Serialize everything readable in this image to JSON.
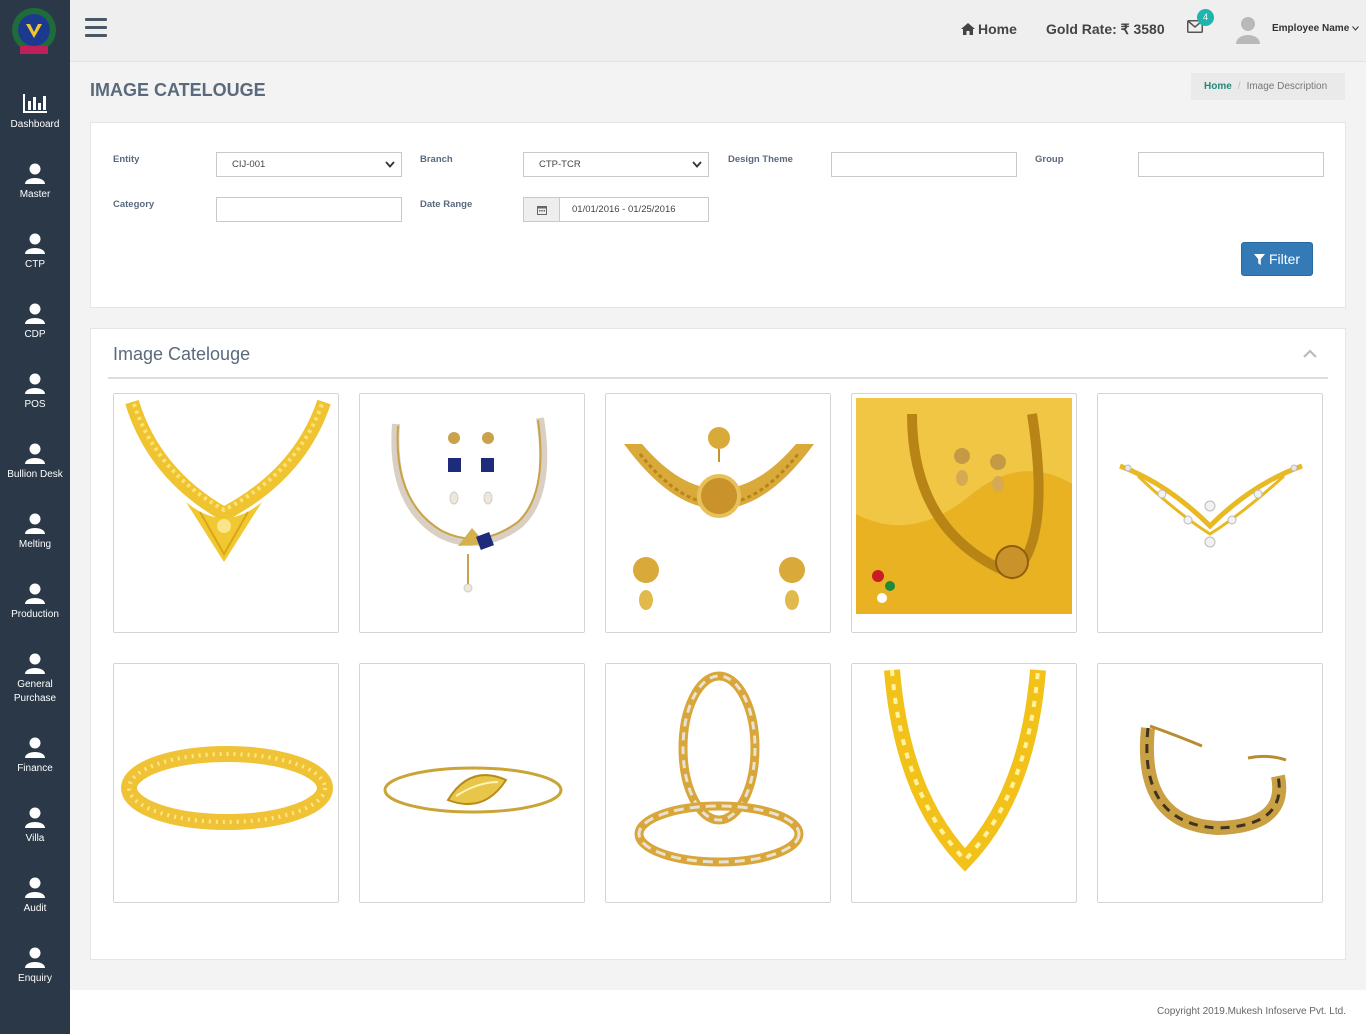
{
  "sidebar": {
    "logo_icon": "lion-emblem-logo-icon",
    "items": [
      {
        "label": "Dashboard",
        "icon": "bar-chart-icon"
      },
      {
        "label": "Master",
        "icon": "user-icon"
      },
      {
        "label": "CTP",
        "icon": "user-icon"
      },
      {
        "label": "CDP",
        "icon": "user-icon"
      },
      {
        "label": "POS",
        "icon": "user-icon"
      },
      {
        "label": "Bullion Desk",
        "icon": "user-icon"
      },
      {
        "label": "Melting",
        "icon": "user-icon"
      },
      {
        "label": "Production",
        "icon": "user-icon"
      },
      {
        "label": "General Purchase",
        "icon": "user-icon"
      },
      {
        "label": "Finance",
        "icon": "user-icon"
      },
      {
        "label": "Villa",
        "icon": "user-icon"
      },
      {
        "label": "Audit",
        "icon": "user-icon"
      },
      {
        "label": "Enquiry",
        "icon": "user-icon"
      }
    ]
  },
  "header": {
    "home_label": "Home",
    "gold_rate": "Gold Rate: ₹ 3580",
    "mail_count": "4",
    "employee_name": "Employee Name"
  },
  "page": {
    "title": "IMAGE CATELOUGE",
    "breadcrumb": {
      "home": "Home",
      "current": "Image Description"
    }
  },
  "filters": {
    "entity_label": "Entity",
    "entity_value": "CIJ-001",
    "branch_label": "Branch",
    "branch_value": "CTP-TCR",
    "design_theme_label": "Design Theme",
    "design_theme_value": "",
    "group_label": "Group",
    "group_value": "",
    "category_label": "Category",
    "category_value": "",
    "date_range_label": "Date Range",
    "date_range_value": "01/01/2016 - 01/25/2016",
    "filter_button": "Filter"
  },
  "catalog": {
    "title": "Image Catelouge",
    "items": [
      {
        "type": "gold-leaf-necklace"
      },
      {
        "type": "sapphire-necklace-earring-set"
      },
      {
        "type": "bridal-choker-set"
      },
      {
        "type": "temple-necklace-set"
      },
      {
        "type": "diamond-gold-pendant-necklace"
      },
      {
        "type": "gold-bangle"
      },
      {
        "type": "leaf-gold-bracelet"
      },
      {
        "type": "two-tone-bangle-pair"
      },
      {
        "type": "gold-curb-chain"
      },
      {
        "type": "gold-link-bracelet"
      }
    ]
  },
  "footer": {
    "copyright": "Copyright 2019.Mukesh Infoserve Pvt. Ltd."
  },
  "colors": {
    "sidebar": "#2a3848",
    "accent": "#337ab7",
    "badge": "#1fb5ad",
    "gold": "#e8b923"
  }
}
